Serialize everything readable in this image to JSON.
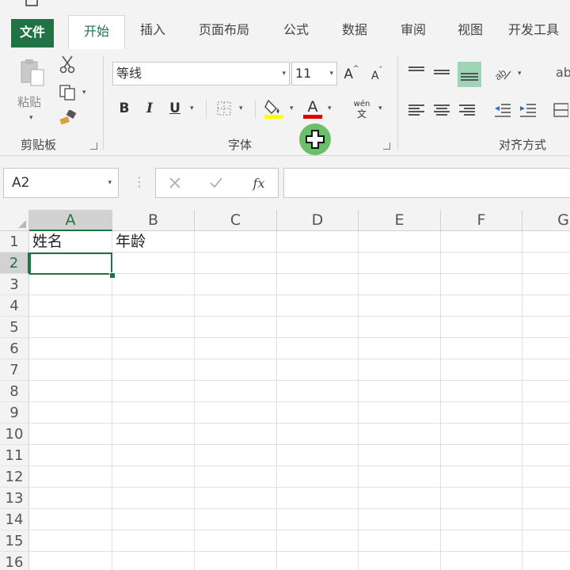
{
  "tabs": [
    {
      "label": "文件"
    },
    {
      "label": "开始"
    },
    {
      "label": "插入"
    },
    {
      "label": "页面布局"
    },
    {
      "label": "公式"
    },
    {
      "label": "数据"
    },
    {
      "label": "审阅"
    },
    {
      "label": "视图"
    },
    {
      "label": "开发工具"
    }
  ],
  "ribbon": {
    "clipboard": {
      "label": "剪贴板",
      "paste_label": "粘贴"
    },
    "font": {
      "label": "字体",
      "font_name": "等线",
      "font_size": "11",
      "bold": "B",
      "italic": "I",
      "underline": "U",
      "font_color_glyph": "A",
      "grow_glyph": "A",
      "shrink_glyph": "A",
      "phonetic_top": "wén",
      "phonetic_bottom": "文"
    },
    "alignment": {
      "label": "对齐方式",
      "wrap_fragment": "ab"
    }
  },
  "formula_bar": {
    "name_box": "A2",
    "fx_label": "fx",
    "formula": ""
  },
  "sheet": {
    "columns": [
      "A",
      "B",
      "C",
      "D",
      "E",
      "F",
      "G"
    ],
    "rows": [
      "1",
      "2",
      "3",
      "4",
      "5",
      "6",
      "7",
      "8",
      "9",
      "10",
      "11",
      "12",
      "13",
      "14",
      "15",
      "16"
    ],
    "cells": {
      "A1": "姓名",
      "B1": "年龄"
    },
    "active_cell": "A2"
  },
  "colors": {
    "accent": "#217346",
    "highlight_fill": "#ffff00",
    "font_color": "#e00000",
    "cursor": "#6bbf6b"
  },
  "icons": [
    "cut-icon",
    "copy-icon",
    "format-painter-icon",
    "paste-icon",
    "fill-color-icon",
    "borders-icon",
    "orientation-icon",
    "indent-icon",
    "cancel-icon",
    "enter-icon",
    "insert-function-icon",
    "move-cursor-icon"
  ]
}
